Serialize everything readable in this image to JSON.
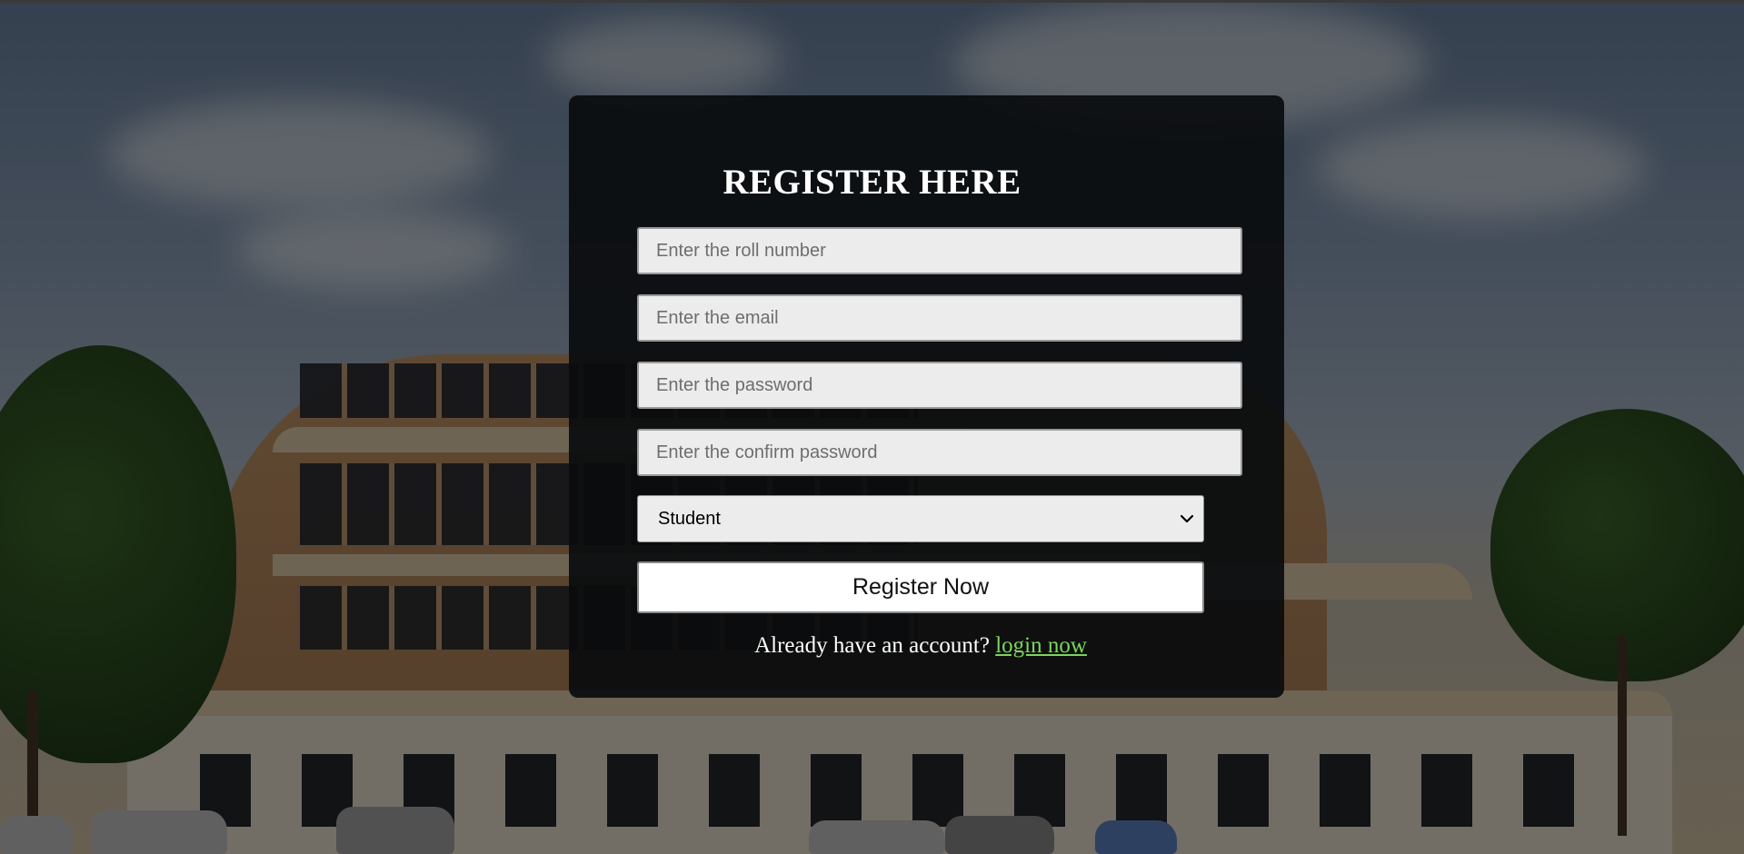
{
  "form": {
    "title": "REGISTER HERE",
    "fields": {
      "roll_number": {
        "placeholder": "Enter the roll number",
        "value": ""
      },
      "email": {
        "placeholder": "Enter the email",
        "value": ""
      },
      "password": {
        "placeholder": "Enter the password",
        "value": ""
      },
      "confirm_password": {
        "placeholder": "Enter the confirm password",
        "value": ""
      }
    },
    "role_select": {
      "selected": "Student"
    },
    "submit_label": "Register Now",
    "signin_prompt": "Already have an account?",
    "signin_link_label": "login now"
  },
  "colors": {
    "panel_background": "#0a0c0e",
    "title_text": "#ffffff",
    "input_background": "#ececec",
    "link": "#7bd65b",
    "button_background": "#ffffff"
  },
  "icons": {
    "select_caret": "chevron-down-icon"
  }
}
